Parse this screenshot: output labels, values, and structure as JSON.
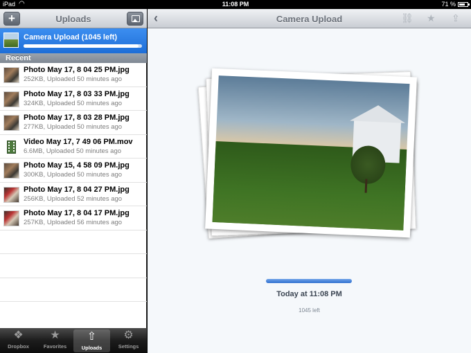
{
  "status_bar": {
    "carrier": "iPad",
    "wifi_icon": "wifi-icon",
    "time": "11:08 PM",
    "battery_pct": "71 %",
    "battery_level": 0.71
  },
  "left_panel": {
    "title": "Uploads",
    "add_icon": "plus-icon",
    "photo_icon": "photo-icon",
    "current_upload": {
      "label": "Camera Upload (1045 left)",
      "progress": 0.97
    },
    "section_header": "Recent",
    "items": [
      {
        "name": "Photo May 17, 8 04 25 PM.jpg",
        "meta": "252KB, Uploaded 50 minutes ago",
        "thumb": "photo"
      },
      {
        "name": "Photo May 17, 8 03 33 PM.jpg",
        "meta": "324KB, Uploaded 50 minutes ago",
        "thumb": "photo"
      },
      {
        "name": "Photo May 17, 8 03 28 PM.jpg",
        "meta": "277KB, Uploaded 50 minutes ago",
        "thumb": "photo"
      },
      {
        "name": "Video May 17, 7 49 06 PM.mov",
        "meta": "6.6MB, Uploaded 50 minutes ago",
        "thumb": "video"
      },
      {
        "name": "Photo May 15, 4 58 09 PM.jpg",
        "meta": "300KB, Uploaded 50 minutes ago",
        "thumb": "photo"
      },
      {
        "name": "Photo May 17, 8 04 27 PM.jpg",
        "meta": "256KB, Uploaded 52 minutes ago",
        "thumb": "red"
      },
      {
        "name": "Photo May 17, 8 04 17 PM.jpg",
        "meta": "257KB, Uploaded 56 minutes ago",
        "thumb": "red"
      }
    ]
  },
  "tab_bar": {
    "tabs": [
      {
        "label": "Dropbox",
        "icon": "dropbox-icon",
        "active": false
      },
      {
        "label": "Favorites",
        "icon": "star-icon",
        "active": false
      },
      {
        "label": "Uploads",
        "icon": "upload-icon",
        "active": true
      },
      {
        "label": "Settings",
        "icon": "gear-icon",
        "active": false
      }
    ]
  },
  "right_panel": {
    "back_icon": "chevron-left-icon",
    "title": "Camera Upload",
    "actions": [
      "link-icon",
      "star-icon",
      "share-icon"
    ],
    "progress": 1.0,
    "timestamp": "Today at 11:08 PM",
    "remaining": "1045 left"
  },
  "colors": {
    "accent_blue": "#1e6ed7",
    "nav_gray": "#c9cdd3",
    "tab_bar_dark": "#1c1c1c"
  }
}
